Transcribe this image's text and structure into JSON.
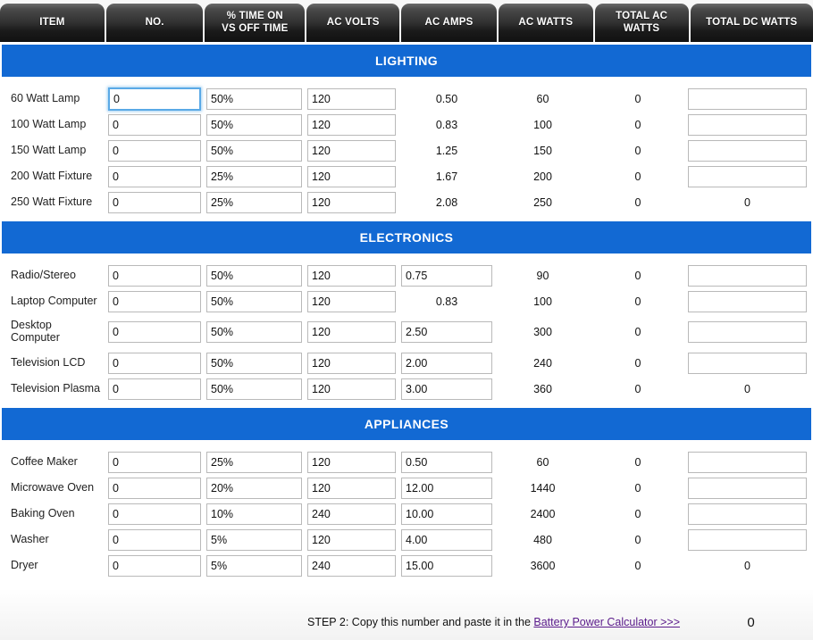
{
  "table": {
    "headers": [
      {
        "id": "item",
        "lines": [
          "ITEM"
        ]
      },
      {
        "id": "no",
        "lines": [
          "NO."
        ]
      },
      {
        "id": "pct",
        "lines": [
          "% TIME ON",
          "VS OFF TIME"
        ]
      },
      {
        "id": "volts",
        "lines": [
          "AC VOLTS"
        ]
      },
      {
        "id": "amps",
        "lines": [
          "AC AMPS"
        ]
      },
      {
        "id": "watts",
        "lines": [
          "AC WATTS"
        ]
      },
      {
        "id": "tacw",
        "lines": [
          "TOTAL AC WATTS"
        ]
      },
      {
        "id": "tdcw",
        "lines": [
          "TOTAL DC WATTS"
        ]
      }
    ]
  },
  "sections": [
    {
      "title": "LIGHTING",
      "rows": [
        {
          "item": "60 Watt Lamp",
          "no": "0",
          "pct": "50%",
          "volts": "120",
          "amps": "0.50",
          "watts": "60",
          "total_ac": "0",
          "total_dc": ""
        },
        {
          "item": "100 Watt Lamp",
          "no": "0",
          "pct": "50%",
          "volts": "120",
          "amps": "0.83",
          "watts": "100",
          "total_ac": "0",
          "total_dc": ""
        },
        {
          "item": "150 Watt Lamp",
          "no": "0",
          "pct": "50%",
          "volts": "120",
          "amps": "1.25",
          "watts": "150",
          "total_ac": "0",
          "total_dc": ""
        },
        {
          "item": "200 Watt Fixture",
          "no": "0",
          "pct": "25%",
          "volts": "120",
          "amps": "1.67",
          "watts": "200",
          "total_ac": "0",
          "total_dc": ""
        },
        {
          "item": "250 Watt Fixture",
          "no": "0",
          "pct": "25%",
          "volts": "120",
          "amps": "2.08",
          "watts": "250",
          "total_ac": "0",
          "total_dc": "0"
        }
      ]
    },
    {
      "title": "ELECTRONICS",
      "rows": [
        {
          "item": "Radio/Stereo",
          "no": "0",
          "pct": "50%",
          "volts": "120",
          "amps": "0.75",
          "watts": "90",
          "total_ac": "0",
          "total_dc": ""
        },
        {
          "item": "Laptop Computer",
          "no": "0",
          "pct": "50%",
          "volts": "120",
          "amps": "0.83",
          "watts": "100",
          "total_ac": "0",
          "total_dc": ""
        },
        {
          "item": "Desktop Computer",
          "no": "0",
          "pct": "50%",
          "volts": "120",
          "amps": "2.50",
          "watts": "300",
          "total_ac": "0",
          "total_dc": ""
        },
        {
          "item": "Television LCD",
          "no": "0",
          "pct": "50%",
          "volts": "120",
          "amps": "2.00",
          "watts": "240",
          "total_ac": "0",
          "total_dc": ""
        },
        {
          "item": "Television Plasma",
          "no": "0",
          "pct": "50%",
          "volts": "120",
          "amps": "3.00",
          "watts": "360",
          "total_ac": "0",
          "total_dc": "0"
        }
      ]
    },
    {
      "title": "APPLIANCES",
      "rows": [
        {
          "item": "Coffee Maker",
          "no": "0",
          "pct": "25%",
          "volts": "120",
          "amps": "0.50",
          "watts": "60",
          "total_ac": "0",
          "total_dc": ""
        },
        {
          "item": "Microwave Oven",
          "no": "0",
          "pct": "20%",
          "volts": "120",
          "amps": "12.00",
          "watts": "1440",
          "total_ac": "0",
          "total_dc": ""
        },
        {
          "item": "Baking Oven",
          "no": "0",
          "pct": "10%",
          "volts": "240",
          "amps": "10.00",
          "watts": "2400",
          "total_ac": "0",
          "total_dc": ""
        },
        {
          "item": "Washer",
          "no": "0",
          "pct": "5%",
          "volts": "120",
          "amps": "4.00",
          "watts": "480",
          "total_ac": "0",
          "total_dc": ""
        },
        {
          "item": "Dryer",
          "no": "0",
          "pct": "5%",
          "volts": "240",
          "amps": "15.00",
          "watts": "3600",
          "total_ac": "0",
          "total_dc": "0"
        }
      ]
    }
  ],
  "footer": {
    "step_text": "STEP 2: Copy this number and paste it in the ",
    "link_label": "Battery Power Calculator >>>",
    "total": "0"
  },
  "colors": {
    "band_blue": "#1269d3",
    "header_dark": "#1b1b1b",
    "link_purple": "#5a1a8b",
    "focus_blue": "#5aa9e6"
  }
}
